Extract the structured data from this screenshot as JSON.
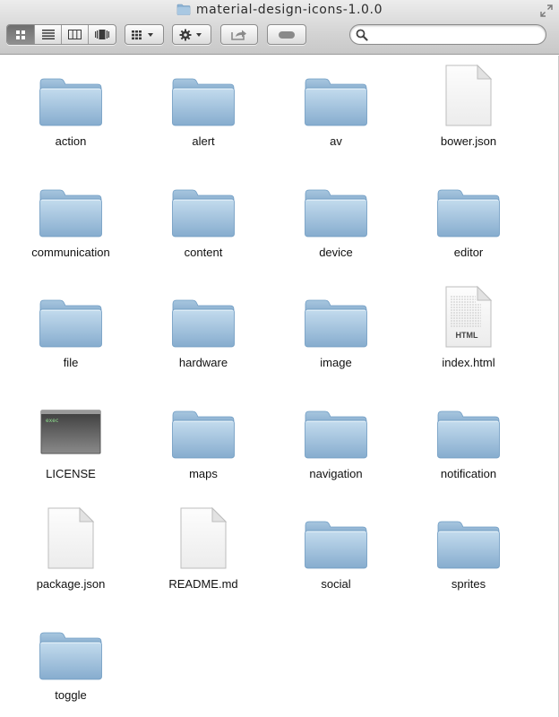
{
  "window": {
    "title": "material-design-icons-1.0.0"
  },
  "toolbar": {
    "view_buttons": [
      "icon-view-icon",
      "list-view-icon",
      "column-view-icon",
      "cover-flow-icon"
    ],
    "arrange_button": "arrange-icon",
    "action_button": "gear-icon",
    "share_button": "share-icon",
    "tags_button": "toggle-pill-icon",
    "search_placeholder": ""
  },
  "files": [
    {
      "name": "action",
      "type": "folder"
    },
    {
      "name": "alert",
      "type": "folder"
    },
    {
      "name": "av",
      "type": "folder"
    },
    {
      "name": "bower.json",
      "type": "document"
    },
    {
      "name": "communication",
      "type": "folder"
    },
    {
      "name": "content",
      "type": "folder"
    },
    {
      "name": "device",
      "type": "folder"
    },
    {
      "name": "editor",
      "type": "folder"
    },
    {
      "name": "file",
      "type": "folder"
    },
    {
      "name": "hardware",
      "type": "folder"
    },
    {
      "name": "image",
      "type": "folder"
    },
    {
      "name": "index.html",
      "type": "html",
      "badge": "HTML"
    },
    {
      "name": "LICENSE",
      "type": "exec",
      "badge": "exec"
    },
    {
      "name": "maps",
      "type": "folder"
    },
    {
      "name": "navigation",
      "type": "folder"
    },
    {
      "name": "notification",
      "type": "folder"
    },
    {
      "name": "package.json",
      "type": "document"
    },
    {
      "name": "README.md",
      "type": "document"
    },
    {
      "name": "social",
      "type": "folder"
    },
    {
      "name": "sprites",
      "type": "folder"
    },
    {
      "name": "toggle",
      "type": "folder"
    }
  ],
  "colors": {
    "folder_light": "#b9d3e7",
    "folder_dark": "#88aecf",
    "folder_tab": "#a5c4de"
  }
}
